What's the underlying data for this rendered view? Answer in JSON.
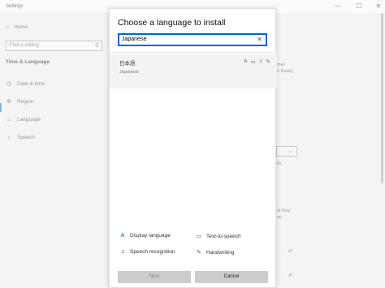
{
  "window": {
    "title": "Settings",
    "buttons": [
      "—",
      "☐",
      "✕"
    ]
  },
  "sidebar": {
    "home_label": "Home",
    "search_placeholder": "Find a setting",
    "section_title": "Time & Language",
    "items": [
      {
        "label": "Date & time",
        "icon": "calendar-clock-icon",
        "glyph": "◷"
      },
      {
        "label": "Region",
        "icon": "globe-icon",
        "glyph": "⊕"
      },
      {
        "label": "Language",
        "icon": "language-icon",
        "glyph": "⌂"
      },
      {
        "label": "Speech",
        "icon": "microphone-icon",
        "glyph": "♪"
      }
    ]
  },
  "background_right": {
    "line1": "mat",
    "line2": "n Basis)",
    "line3": "ils",
    "line4": "at they",
    "line5": "ay"
  },
  "dialog": {
    "title": "Choose a language to install",
    "search_value": "Japanese",
    "result": {
      "native_name": "日本語",
      "english_name": "Japanese",
      "feature_icons": [
        "display-language-icon",
        "text-to-speech-icon",
        "speech-recognition-icon",
        "handwriting-icon"
      ]
    },
    "legend": {
      "display_language": "Display language",
      "text_to_speech": "Text-to-speech",
      "speech_recognition": "Speech recognition",
      "handwriting": "Handwriting"
    },
    "next_label": "Next",
    "cancel_label": "Cancel"
  },
  "colors": {
    "accent": "#0067c0",
    "dialog_bg": "#ffffff",
    "selected_row": "#f3f3f3",
    "button_bg": "#cccccc"
  }
}
